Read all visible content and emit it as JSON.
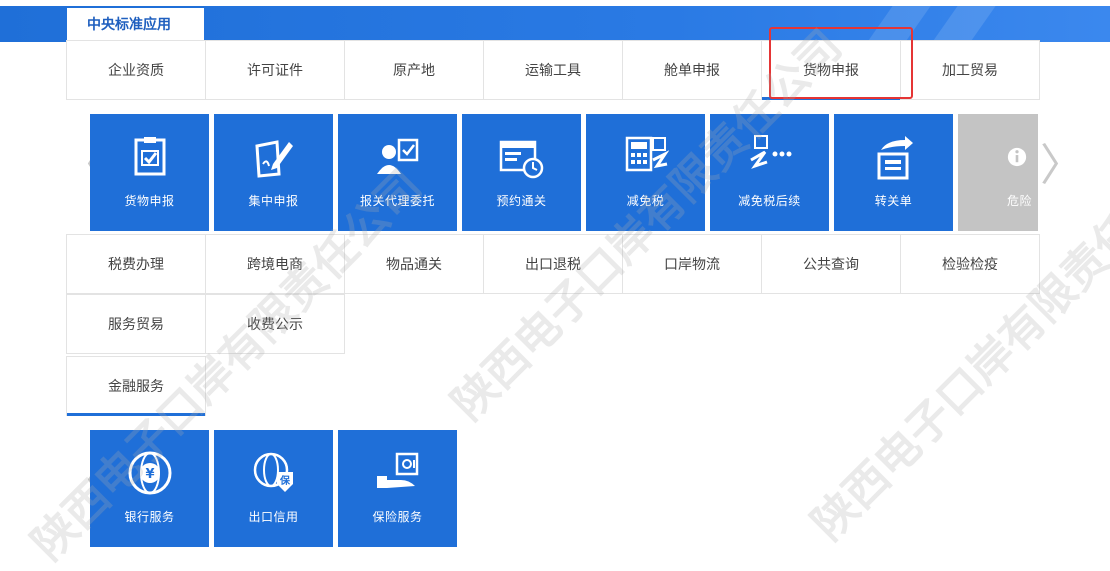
{
  "header": {
    "main_tab": "中央标准应用"
  },
  "row1_tabs": [
    "企业资质",
    "许可证件",
    "原产地",
    "运输工具",
    "舱单申报",
    "货物申报",
    "加工贸易"
  ],
  "tiles1": [
    {
      "label": "货物申报",
      "icon": "clipboard-check-icon"
    },
    {
      "label": "集中申报",
      "icon": "pen-document-icon"
    },
    {
      "label": "报关代理委托",
      "icon": "agent-clipboard-icon"
    },
    {
      "label": "预约通关",
      "icon": "browser-clock-icon"
    },
    {
      "label": "减免税",
      "icon": "calculator-icon"
    },
    {
      "label": "减免税后续",
      "icon": "tax-followup-icon"
    },
    {
      "label": "转关单",
      "icon": "transfer-document-icon"
    },
    {
      "label": "危险",
      "icon": "info-icon"
    }
  ],
  "row2_tabs": [
    "税费办理",
    "跨境电商",
    "物品通关",
    "出口退税",
    "口岸物流",
    "公共查询",
    "检验检疫"
  ],
  "row3_tabs": [
    "服务贸易",
    "收费公示"
  ],
  "row4_tabs": [
    "金融服务"
  ],
  "tiles2": [
    {
      "label": "银行服务",
      "icon": "bank-globe-icon"
    },
    {
      "label": "出口信用",
      "icon": "export-credit-icon"
    },
    {
      "label": "保险服务",
      "icon": "insurance-safe-icon"
    }
  ],
  "watermark": "陕西电子口岸有限责任公司",
  "colors": {
    "primary": "#1f6fd8",
    "highlight": "#e53535",
    "disabled": "#c4c4c4"
  },
  "arrows": {
    "left": "〈",
    "right": "〉"
  }
}
